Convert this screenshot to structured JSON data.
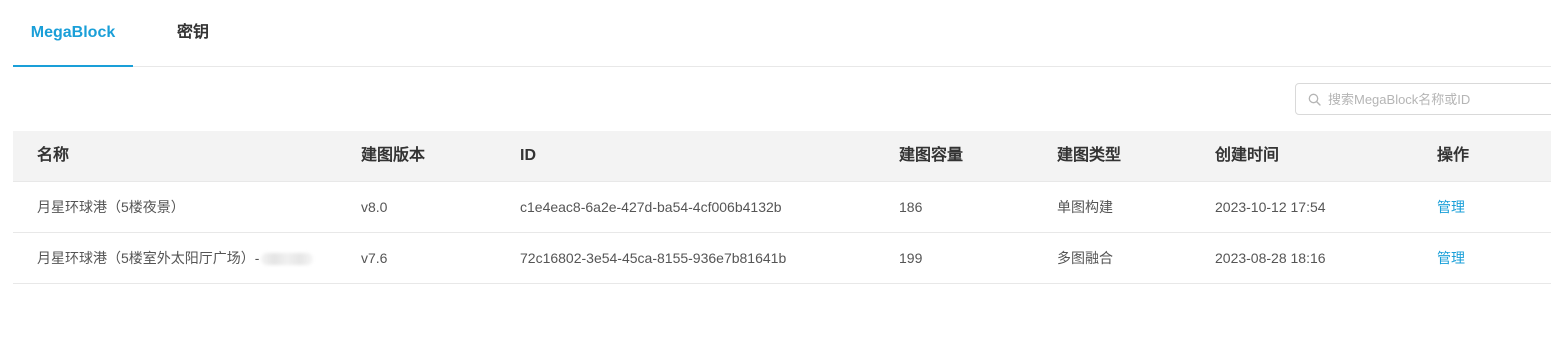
{
  "tabs": [
    {
      "label": "MegaBlock",
      "active": true
    },
    {
      "label": "密钥",
      "active": false
    }
  ],
  "search": {
    "placeholder": "搜索MegaBlock名称或ID",
    "value": ""
  },
  "table": {
    "columns": [
      "名称",
      "建图版本",
      "ID",
      "建图容量",
      "建图类型",
      "创建时间",
      "操作"
    ],
    "rows": [
      {
        "name": "月星环球港（5楼夜景）",
        "version": "v8.0",
        "id": "c1e4eac8-6a2e-427d-ba54-4cf006b4132b",
        "capacity": "186",
        "type": "单图构建",
        "created": "2023-10-12 17:54",
        "action": "管理"
      },
      {
        "name": "月星环球港（5楼室外太阳厅广场）-",
        "version": "v7.6",
        "id": "72c16802-3e54-45ca-8155-936e7b81641b",
        "capacity": "199",
        "type": "多图融合",
        "created": "2023-08-28 18:16",
        "action": "管理"
      }
    ]
  },
  "colors": {
    "accent": "#1a9fd8",
    "header_bg": "#f3f3f3",
    "border": "#e8e8e8"
  },
  "icons": {
    "search": "search-icon"
  }
}
